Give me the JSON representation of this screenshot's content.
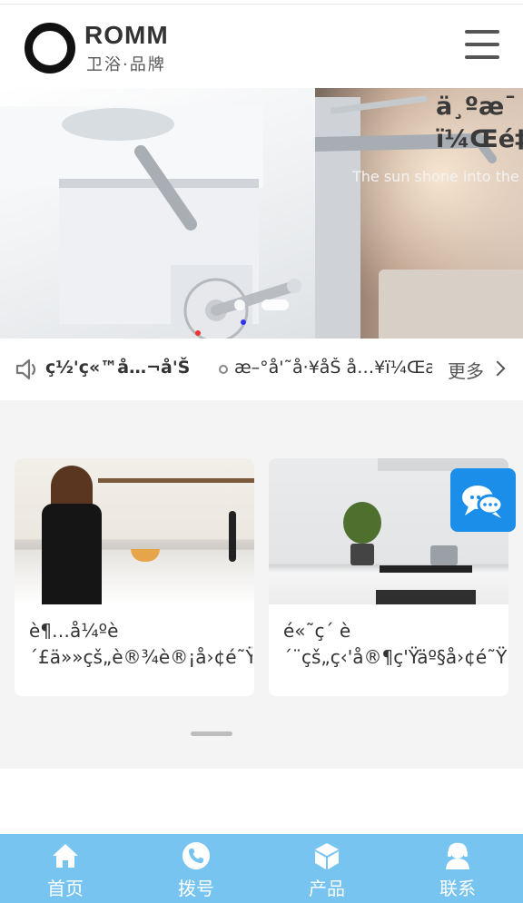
{
  "header": {
    "logo_text": "ROMM",
    "logo_subtitle": "卫浴·品牌",
    "menu_icon": "hamburger-menu-icon"
  },
  "banner": {
    "title_line1": "ä¸ºæ¯",
    "title_line2": "ï¼Œé‡",
    "subtitle": "The sun shone into the",
    "slide_count": 2,
    "active_slide": 2
  },
  "notice": {
    "icon": "speaker-icon",
    "label": "ç½'ç«™å…¬å'Š",
    "headline": "æ–°å'˜å·¥åŠ å…¥ï¼Œæ",
    "more_label": "更多"
  },
  "cards": [
    {
      "title": "è¶…å¼ºè´£ä»»çš„è®¾è®¡å›¢é˜Ÿ",
      "image_icon": "kitchen-woman-photo"
    },
    {
      "title": "é«˜ç´ è´¨çš„ç‹'å®¶ç'Ÿäº§å›¢é˜Ÿ",
      "image_icon": "kitchen-stove-photo"
    }
  ],
  "chat": {
    "icon": "chat-bubbles-icon"
  },
  "tabbar": {
    "items": [
      {
        "label": "首页",
        "icon": "home-icon"
      },
      {
        "label": "拨号",
        "icon": "phone-icon"
      },
      {
        "label": "产品",
        "icon": "cube-icon"
      },
      {
        "label": "联系",
        "icon": "contact-icon"
      }
    ]
  },
  "colors": {
    "tabbar_bg": "#77c4f0",
    "chat_bg": "#1a8ee8",
    "page_bg": "#f4f4f4"
  }
}
